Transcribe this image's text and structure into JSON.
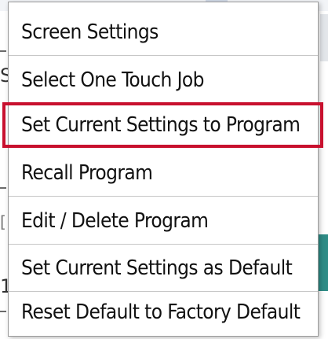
{
  "background": {
    "left_glyphs": [
      "S",
      "[",
      "1"
    ]
  },
  "menu": {
    "items": [
      {
        "label": "Screen Settings",
        "selected": false
      },
      {
        "label": "Select One Touch Job",
        "selected": false
      },
      {
        "label": "Set Current Settings to Program",
        "selected": true
      },
      {
        "label": "Recall Program",
        "selected": false
      },
      {
        "label": "Edit / Delete Program",
        "selected": false
      },
      {
        "label": "Set Current Settings as Default",
        "selected": false
      },
      {
        "label": "Reset Default to Factory Default",
        "selected": false
      }
    ],
    "highlight_color": "#c8102e"
  }
}
